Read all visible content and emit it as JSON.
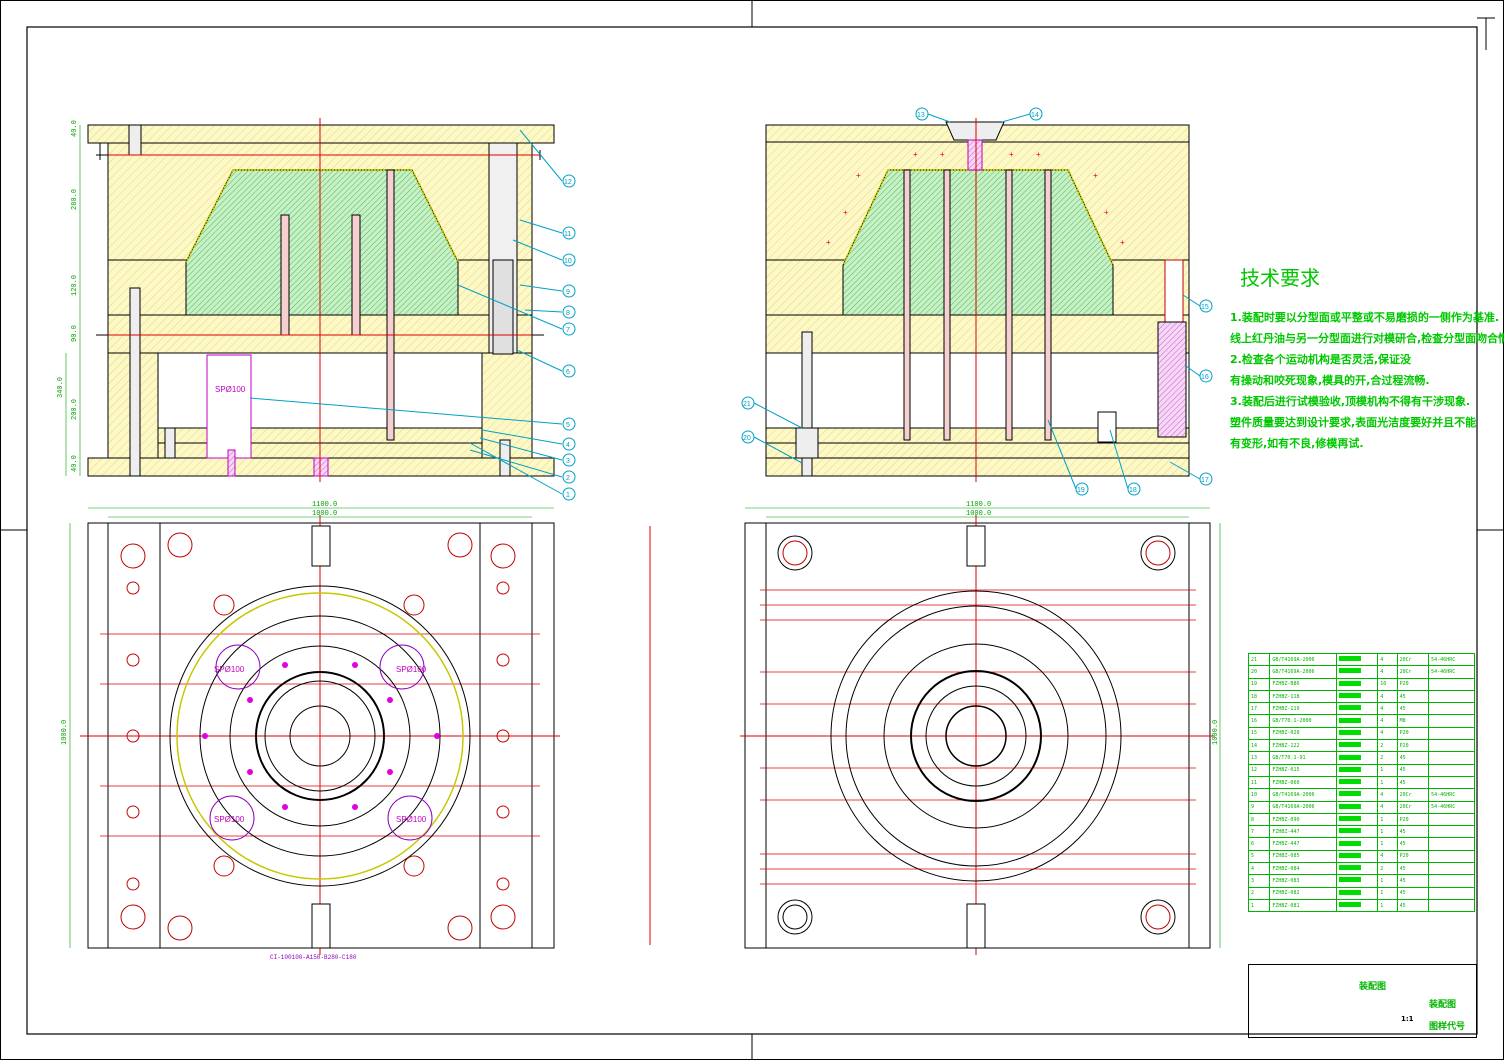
{
  "tech_requirements": {
    "title": "技术要求",
    "lines": [
      "1.装配时要以分型面或平整或不易磨损的一侧作为基准.",
      "线上红丹油与另一分型面进行对模研合,检查分型面吻合情况.",
      "2.检查各个运动机构是否灵活,保证没",
      "有操动和咬死现象,模具的开,合过程流畅.",
      "3.装配后进行试模验收,顶模机构不得有干涉现象.",
      "塑件质量要达到设计要求,表面光洁度要好并且不能",
      "有变形,如有不良,修模再试."
    ]
  },
  "dimensions": {
    "front_height_total": "340.0",
    "dim_40_top": "40.0",
    "dim_280": "280.0",
    "dim_120": "120.0",
    "dim_90": "90.0",
    "dim_200": "200.0",
    "dim_40_bottom": "40.0",
    "width_outer": "1100.0",
    "width_inner": "1000.0",
    "height_plan": "1000.0",
    "right_width_outer": "1100.0",
    "right_width_inner": "1000.0",
    "right_height": "1000.0"
  },
  "plan_labels": {
    "sp_center": "SPØ100",
    "sp_tl": "SPØ100",
    "sp_tr": "SPØ100",
    "sp_bl": "SPØ100",
    "sp_br": "SPØ100",
    "mold_code": "CI-100100-A150-B280-C180"
  },
  "balloons_left": [
    "1",
    "2",
    "3",
    "4",
    "5",
    "6",
    "7",
    "8",
    "9",
    "10",
    "11",
    "12"
  ],
  "balloons_right": [
    "13",
    "14",
    "15",
    "16",
    "17",
    "18",
    "19",
    "20",
    "21"
  ],
  "bom_rows": [
    {
      "no": "21",
      "code": "GB/T4169A-2006",
      "qty": "4",
      "mat": "20Cr",
      "note": "54-46HRC"
    },
    {
      "no": "20",
      "code": "GB/T4169A-2006",
      "qty": "4",
      "mat": "20Cr",
      "note": "54-46HRC"
    },
    {
      "no": "19",
      "code": "FZHBZ-B86",
      "qty": "10",
      "mat": "P20",
      "note": ""
    },
    {
      "no": "18",
      "code": "FZHBZ-118",
      "qty": "4",
      "mat": "45",
      "note": ""
    },
    {
      "no": "17",
      "code": "FZHBZ-119",
      "qty": "4",
      "mat": "45",
      "note": ""
    },
    {
      "no": "16",
      "code": "GB/T70.1-2000",
      "qty": "4",
      "mat": "M8",
      "note": ""
    },
    {
      "no": "15",
      "code": "FZHBZ-020",
      "qty": "4",
      "mat": "P20",
      "note": ""
    },
    {
      "no": "14",
      "code": "FZHBZ-122",
      "qty": "2",
      "mat": "P20",
      "note": ""
    },
    {
      "no": "13",
      "code": "GB/T70.1-91",
      "qty": "2",
      "mat": "45",
      "note": ""
    },
    {
      "no": "12",
      "code": "FZHBZ-015",
      "qty": "1",
      "mat": "45",
      "note": ""
    },
    {
      "no": "11",
      "code": "FZHBZ-060",
      "qty": "1",
      "mat": "45",
      "note": ""
    },
    {
      "no": "10",
      "code": "GB/T4169A-2006",
      "qty": "4",
      "mat": "20Cr",
      "note": "54-46HRC"
    },
    {
      "no": "9",
      "code": "GB/T4169A-2006",
      "qty": "4",
      "mat": "20Cr",
      "note": "54-46HRC"
    },
    {
      "no": "8",
      "code": "FZHBZ-090",
      "qty": "1",
      "mat": "P20",
      "note": ""
    },
    {
      "no": "7",
      "code": "FZHBZ-447",
      "qty": "1",
      "mat": "45",
      "note": ""
    },
    {
      "no": "6",
      "code": "FZHBZ-447",
      "qty": "1",
      "mat": "45",
      "note": ""
    },
    {
      "no": "5",
      "code": "FZHBZ-085",
      "qty": "4",
      "mat": "P20",
      "note": ""
    },
    {
      "no": "4",
      "code": "FZHBZ-084",
      "qty": "2",
      "mat": "45",
      "note": ""
    },
    {
      "no": "3",
      "code": "FZHBZ-083",
      "qty": "1",
      "mat": "45",
      "note": ""
    },
    {
      "no": "2",
      "code": "FZHBZ-082",
      "qty": "1",
      "mat": "45",
      "note": ""
    },
    {
      "no": "1",
      "code": "FZHBZ-081",
      "qty": "1",
      "mat": "45",
      "note": ""
    }
  ],
  "title_block": {
    "drawing_name_1": "装配图",
    "drawing_name_2": "装配图",
    "scale": "1:1",
    "drawing_code_label": "图样代号"
  },
  "colors": {
    "plate_fill": "#fdf8c8",
    "cavity_fill": "#c8f0c8",
    "hatch_plate": "#d8c830",
    "hatch_cavity": "#18b018",
    "centerline": "#e00000",
    "outline": "#000000",
    "dimension": "#00a000",
    "balloon": "#00a0c8",
    "magenta": "#c000c0"
  }
}
